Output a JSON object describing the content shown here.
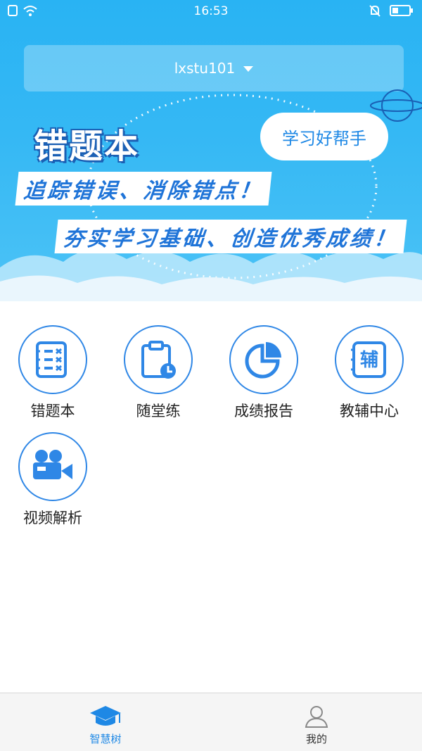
{
  "status_bar": {
    "time": "16:53"
  },
  "account": {
    "username": "lxstu101"
  },
  "banner": {
    "title": "错题本",
    "bubble": "学习好帮手",
    "slogan1": "追踪错误、消除错点！",
    "slogan2": "夯实学习基础、创造优秀成绩！"
  },
  "menu": {
    "items": [
      {
        "label": "错题本",
        "icon": "checklist-icon"
      },
      {
        "label": "随堂练",
        "icon": "clipboard-clock-icon"
      },
      {
        "label": "成绩报告",
        "icon": "pie-chart-icon"
      },
      {
        "label": "教辅中心",
        "icon": "notebook-fu-icon",
        "badge": "辅"
      },
      {
        "label": "视频解析",
        "icon": "video-camera-icon"
      }
    ]
  },
  "bottom_nav": {
    "items": [
      {
        "label": "智慧树",
        "icon": "graduation-cap-icon",
        "active": true
      },
      {
        "label": "我的",
        "icon": "user-icon",
        "active": false
      }
    ]
  },
  "colors": {
    "accent": "#2f87e6",
    "banner": "#35b8f4"
  }
}
